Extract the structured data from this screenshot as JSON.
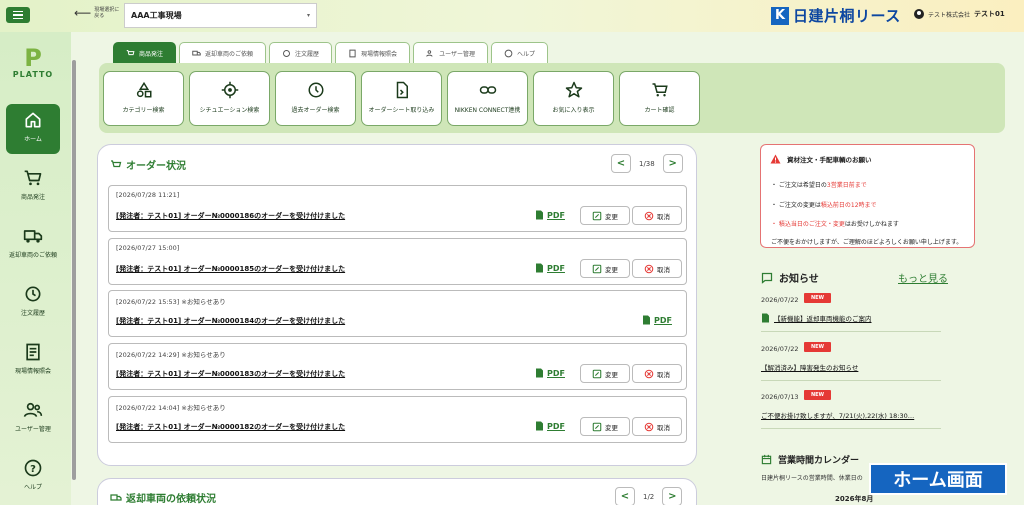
{
  "header": {
    "back_label": "現場選択に戻る",
    "site_name": "AAA工事現場",
    "brand_mark": "K",
    "brand_name": "日建片桐リース",
    "company": "テスト株式会社",
    "username": "テスト01"
  },
  "sidebar": {
    "logo_text": "PLATTO",
    "items": [
      {
        "label": "ホーム",
        "icon": "home-icon"
      },
      {
        "label": "商品発注",
        "icon": "cart-icon"
      },
      {
        "label": "返却車両のご依頼",
        "icon": "truck-icon"
      },
      {
        "label": "注文履歴",
        "icon": "history-icon"
      },
      {
        "label": "現場情報照会",
        "icon": "document-icon"
      },
      {
        "label": "ユーザー管理",
        "icon": "users-icon"
      },
      {
        "label": "ヘルプ",
        "icon": "help-icon"
      }
    ]
  },
  "tabs": [
    {
      "label": "商品発注",
      "icon": "cart-icon"
    },
    {
      "label": "返却車両のご依頼",
      "icon": "truck-icon"
    },
    {
      "label": "注文履歴",
      "icon": "history-icon"
    },
    {
      "label": "現場情報照会",
      "icon": "document-icon"
    },
    {
      "label": "ユーザー管理",
      "icon": "users-icon"
    },
    {
      "label": "ヘルプ",
      "icon": "help-icon"
    }
  ],
  "functions": [
    {
      "label": "カテゴリー検索",
      "icon": "category-icon"
    },
    {
      "label": "シチュエーション検索",
      "icon": "target-icon"
    },
    {
      "label": "過去オーダー検索",
      "icon": "clock-icon"
    },
    {
      "label": "オーダーシート取り込み",
      "icon": "file-import-icon"
    },
    {
      "label": "NIKKEN CONNECT連携",
      "icon": "link-icon"
    },
    {
      "label": "お気に入り表示",
      "icon": "star-icon"
    },
    {
      "label": "カート確認",
      "icon": "cart-icon"
    }
  ],
  "orders": {
    "title": "オーダー状況",
    "pager": "1/38",
    "pdf_label": "PDF",
    "edit_label": "変更",
    "cancel_label": "取消",
    "rows": [
      {
        "date": "[2026/07/28 11:21]",
        "text": "[発注者：テスト01] オーダー№0000186のオーダーを受け付けました"
      },
      {
        "date": "[2026/07/27 15:00]",
        "text": "[発注者：テスト01] オーダー№0000185のオーダーを受け付けました"
      },
      {
        "date": "[2026/07/22 15:53] ※お知らせあり",
        "text": "[発注者：テスト01] オーダー№0000184のオーダーを受け付けました"
      },
      {
        "date": "[2026/07/22 14:29] ※お知らせあり",
        "text": "[発注者：テスト01] オーダー№0000183のオーダーを受け付けました"
      },
      {
        "date": "[2026/07/22 14:04] ※お知らせあり",
        "text": "[発注者：テスト01] オーダー№0000182のオーダーを受け付けました"
      }
    ]
  },
  "returns": {
    "title": "返却車両の依頼状況",
    "pager": "1/2"
  },
  "alert": {
    "title": "資材注文・手配車輌のお願い",
    "line1_pre": "・ ご注文は希望日の",
    "line1_red": "3営業日前まで",
    "line2_pre": "・ ご注文の変更は",
    "line2_red": "積込前日の12時まで",
    "line3_red": "・ 積込当日のご注文・変更",
    "line3_post": "はお受けしかねます",
    "line4": "ご不便をおかけしますが、ご理解のほどよろしくお願い申し上げます。"
  },
  "news": {
    "title": "お知らせ",
    "more": "もっと見る",
    "badge": "NEW",
    "items": [
      {
        "date": "2026/07/22",
        "text": "【新機能】返却車両機能のご案内"
      },
      {
        "date": "2026/07/22",
        "text": "【解消済み】障害発生のお知らせ"
      },
      {
        "date": "2026/07/13",
        "text": "ご不便お掛け致しますが、7/21(火),22(水) 18:30…"
      }
    ]
  },
  "calendar": {
    "title": "営業時間カレンダー",
    "desc": "日建片桐リースの営業時間、休業日の",
    "month": "2026年8月"
  },
  "overlay_label": "ホーム画面"
}
